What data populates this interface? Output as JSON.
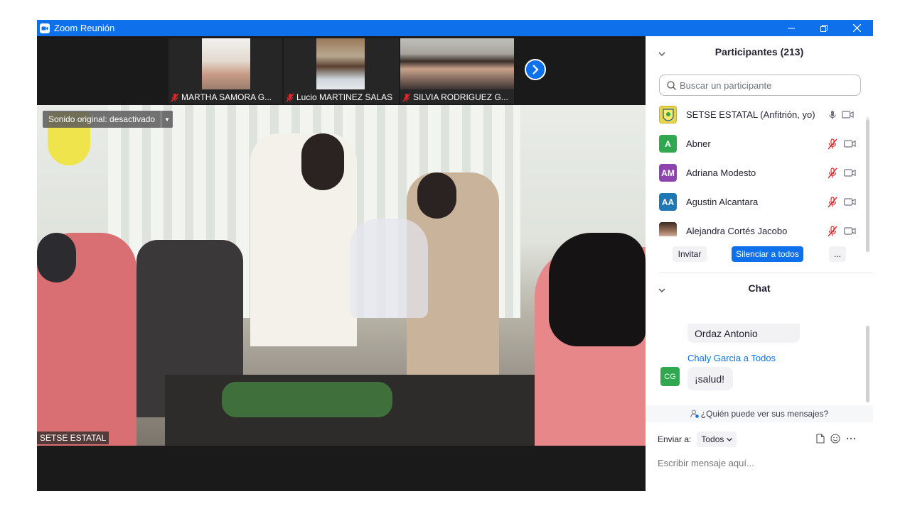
{
  "window": {
    "title": "Zoom Reunión"
  },
  "thumbnails": [
    {
      "name": "MARTHA SAMORA G..."
    },
    {
      "name": "Lucio MARTINEZ SALAS"
    },
    {
      "name": "SILVIA RODRIGUEZ G..."
    }
  ],
  "main_video": {
    "original_sound": "Sonido original: desactivado",
    "speaker": "SETSE ESTATAL"
  },
  "participants": {
    "header": "Participantes (213)",
    "search_placeholder": "Buscar un participante",
    "list": [
      {
        "initials": "",
        "name": "SETSE ESTATAL (Anfitrión, yo)",
        "color": "#e8d44a",
        "muted": false
      },
      {
        "initials": "A",
        "name": "Abner",
        "color": "#2fa84f",
        "muted": true
      },
      {
        "initials": "AM",
        "name": "Adriana Modesto",
        "color": "#8e44ad",
        "muted": true
      },
      {
        "initials": "AA",
        "name": "Agustin Alcantara",
        "color": "#1f77b4",
        "muted": true
      },
      {
        "initials": "",
        "name": "Alejandra Cortés Jacobo",
        "color": "#7a5a4a",
        "muted": true
      }
    ],
    "invite_label": "Invitar",
    "mute_all_label": "Silenciar a todos",
    "more_label": "..."
  },
  "chat": {
    "header": "Chat",
    "messages": [
      {
        "sender": "",
        "initials": "",
        "text": "Ordaz Antonio"
      },
      {
        "sender": "Chaly Garcia a Todos",
        "initials": "CG",
        "text": "¡salud!"
      }
    ],
    "who_can_see": "¿Quién puede ver sus mensajes?",
    "send_to_label": "Enviar a:",
    "send_to_value": "Todos",
    "input_placeholder": "Escribir mensaje aquí..."
  },
  "colors": {
    "accent": "#0e71eb",
    "muted_red": "#e02828"
  }
}
